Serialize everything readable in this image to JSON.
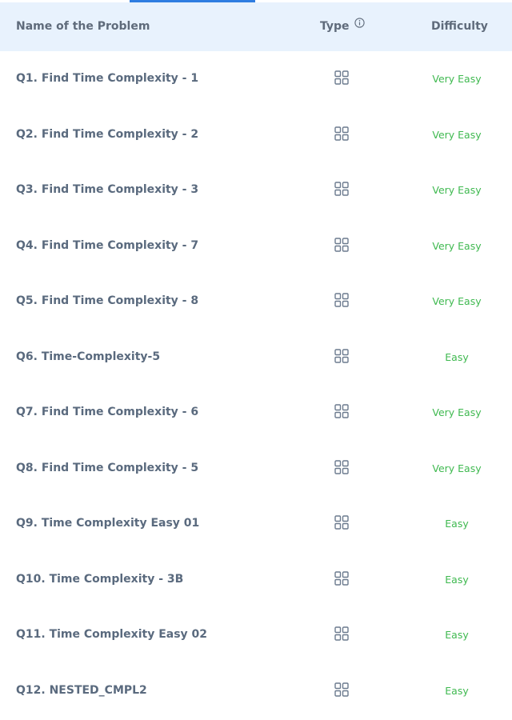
{
  "header": {
    "name_label": "Name of the Problem",
    "type_label": "Type",
    "difficulty_label": "Difficulty"
  },
  "colors": {
    "header_bg": "#e8f2fd",
    "active_tab": "#2f7de1",
    "difficulty_text": "#3fb950",
    "name_text": "#5a6a7e",
    "icon_stroke": "#6b7a8e"
  },
  "icons": {
    "type": "grid-icon",
    "info": "info-icon"
  },
  "problems": [
    {
      "name": "Q1. Find Time Complexity - 1",
      "difficulty": "Very Easy"
    },
    {
      "name": "Q2. Find Time Complexity - 2",
      "difficulty": "Very Easy"
    },
    {
      "name": "Q3. Find Time Complexity - 3",
      "difficulty": "Very Easy"
    },
    {
      "name": "Q4. Find Time Complexity - 7",
      "difficulty": "Very Easy"
    },
    {
      "name": "Q5. Find Time Complexity - 8",
      "difficulty": "Very Easy"
    },
    {
      "name": "Q6. Time-Complexity-5",
      "difficulty": "Easy"
    },
    {
      "name": "Q7. Find Time Complexity - 6",
      "difficulty": "Very Easy"
    },
    {
      "name": "Q8. Find Time Complexity - 5",
      "difficulty": "Very Easy"
    },
    {
      "name": "Q9. Time Complexity Easy 01",
      "difficulty": "Easy"
    },
    {
      "name": "Q10. Time Complexity - 3B",
      "difficulty": "Easy"
    },
    {
      "name": "Q11. Time Complexity Easy 02",
      "difficulty": "Easy"
    },
    {
      "name": "Q12. NESTED_CMPL2",
      "difficulty": "Easy"
    }
  ]
}
